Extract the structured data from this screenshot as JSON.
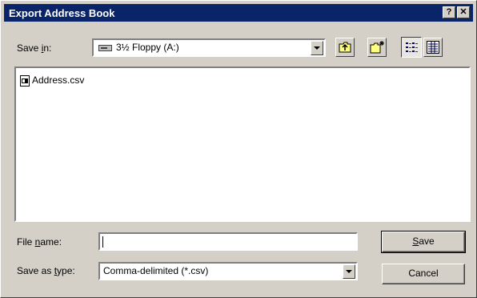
{
  "title": "Export Address Book",
  "title_buttons": {
    "help": "?",
    "close": "✕"
  },
  "save_in": {
    "label_pre": "Save ",
    "label_key": "i",
    "label_post": "n:",
    "value": "3½ Floppy (A:)"
  },
  "toolbar": [
    "up-one-level",
    "create-new-folder",
    "list-view",
    "details-view"
  ],
  "files": [
    {
      "name": "Address.csv",
      "icon": "csv-file-icon"
    }
  ],
  "file_name": {
    "label_pre": "File ",
    "label_key": "n",
    "label_post": "ame:",
    "value": ""
  },
  "save_as_type": {
    "label_pre": "Save as ",
    "label_key": "t",
    "label_post": "ype:",
    "value": "Comma-delimited (*.csv)"
  },
  "buttons": {
    "save_key": "S",
    "save_rest": "ave",
    "cancel": "Cancel"
  },
  "colors": {
    "titlebar": "#0a246a",
    "face": "#d4d0c8"
  }
}
